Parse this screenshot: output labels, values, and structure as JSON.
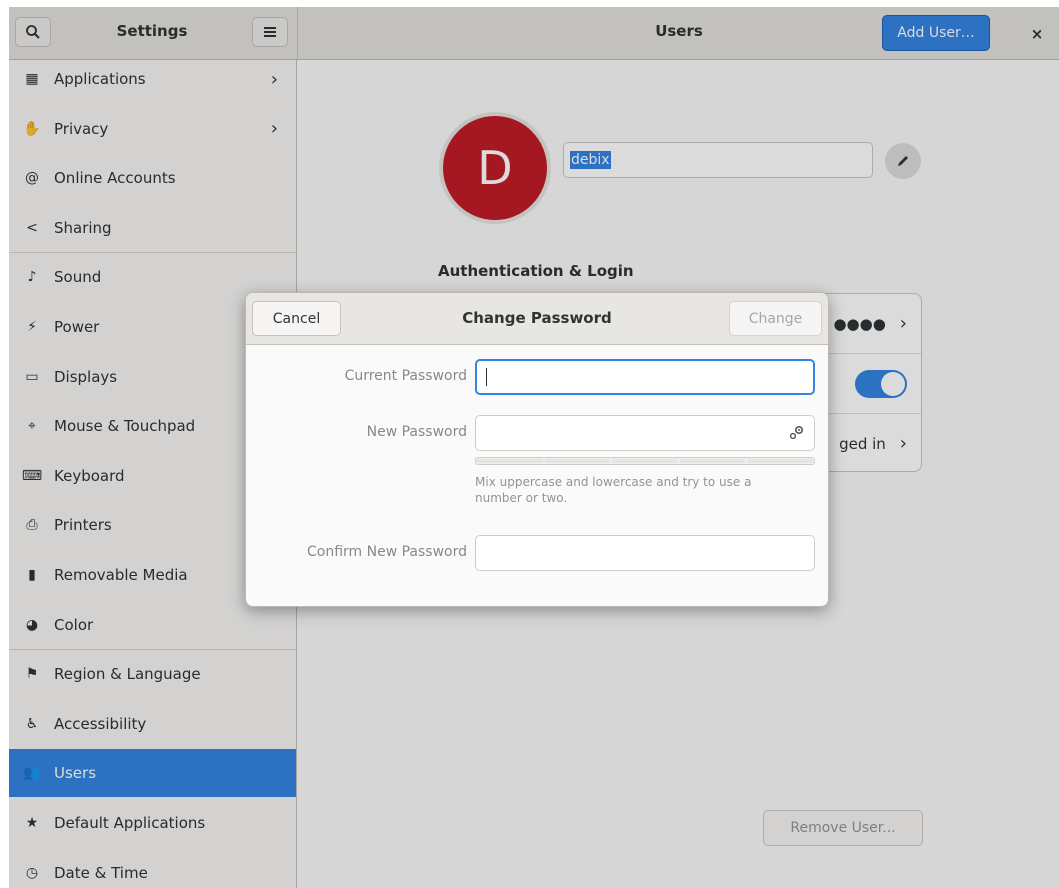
{
  "window": {
    "sidebar_title": "Settings",
    "main_title": "Users",
    "add_user_label": "Add User…",
    "close_glyph": "×"
  },
  "sidebar": {
    "items": [
      {
        "label": "Applications",
        "icon": "applications-icon",
        "glyph": "▦",
        "chevron": "›"
      },
      {
        "label": "Privacy",
        "icon": "privacy-hand-icon",
        "glyph": "✋",
        "chevron": "›"
      },
      {
        "label": "Online Accounts",
        "icon": "online-accounts-icon",
        "glyph": "@"
      },
      {
        "label": "Sharing",
        "icon": "sharing-icon",
        "glyph": "<"
      },
      {
        "label": "Sound",
        "icon": "sound-icon",
        "glyph": "♪"
      },
      {
        "label": "Power",
        "icon": "power-icon",
        "glyph": "⚡"
      },
      {
        "label": "Displays",
        "icon": "displays-icon",
        "glyph": "▭"
      },
      {
        "label": "Mouse & Touchpad",
        "icon": "mouse-icon",
        "glyph": "⌖"
      },
      {
        "label": "Keyboard",
        "icon": "keyboard-icon",
        "glyph": "⌨"
      },
      {
        "label": "Printers",
        "icon": "printer-icon",
        "glyph": "⎙"
      },
      {
        "label": "Removable Media",
        "icon": "removable-media-icon",
        "glyph": "▮"
      },
      {
        "label": "Color",
        "icon": "color-icon",
        "glyph": "◕"
      },
      {
        "label": "Region & Language",
        "icon": "region-flag-icon",
        "glyph": "⚑"
      },
      {
        "label": "Accessibility",
        "icon": "accessibility-icon",
        "glyph": "♿"
      },
      {
        "label": "Users",
        "icon": "users-icon",
        "glyph": "👥",
        "active": true
      },
      {
        "label": "Default Applications",
        "icon": "star-icon",
        "glyph": "★"
      },
      {
        "label": "Date & Time",
        "icon": "clock-icon",
        "glyph": "◷"
      }
    ]
  },
  "user": {
    "avatar_letter": "D",
    "avatar_color": "#c01c28",
    "username": "debix",
    "auth_heading": "Authentication & Login",
    "password_mask": "●●●●",
    "auto_login_tail": "ged in",
    "remove_user_label": "Remove User..."
  },
  "dialog": {
    "title": "Change Password",
    "cancel_label": "Cancel",
    "change_label": "Change",
    "current_label": "Current Password",
    "new_label": "New Password",
    "confirm_label": "Confirm New Password",
    "hint": "Mix uppercase and lowercase and try to use a number or two.",
    "strength_segments": 5
  },
  "colors": {
    "accent": "#3584e4",
    "avatar": "#c01c28"
  }
}
